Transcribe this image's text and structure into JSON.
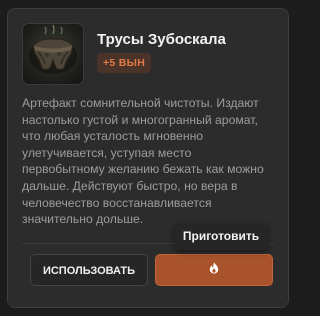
{
  "item": {
    "name": "Трусы Зубоскала",
    "badge": "+5 ВЫН",
    "description_lines": [
      "Артефакт сомнительной чистоты. Издают",
      "настолько густой и многогранный аромат,",
      "что любая усталость мгновенно",
      "улетучивается, уступая место",
      "первобытному желанию бежать как можно",
      "дальше. Действуют быстро, но вера в",
      "человечество восстанавливается",
      "значительно дольше."
    ]
  },
  "actions": {
    "use_label": "ИСПОЛЬЗОВАТЬ",
    "cook_tooltip": "Приготовить",
    "cook_icon": "fire-icon"
  },
  "colors": {
    "accent": "#a8532b",
    "badge_text": "#e37a47",
    "card_bg": "#2c2c2c"
  }
}
